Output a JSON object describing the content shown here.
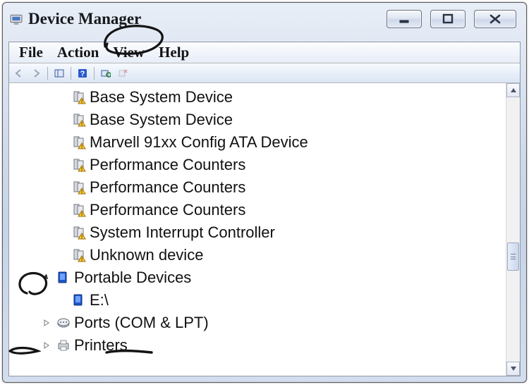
{
  "window": {
    "title": "Device Manager"
  },
  "menu": {
    "file": "File",
    "action": "Action",
    "view": "View",
    "help": "Help"
  },
  "tree": {
    "other_devices": [
      "Base System Device",
      "Base System Device",
      "Marvell 91xx Config ATA Device",
      "Performance Counters",
      "Performance Counters",
      "Performance Counters",
      "System Interrupt Controller",
      "Unknown device"
    ],
    "portable_devices": {
      "label": "Portable Devices",
      "children": [
        "E:\\"
      ]
    },
    "ports": {
      "label": "Ports (COM & LPT)"
    },
    "printers": {
      "label": "Printers"
    }
  }
}
